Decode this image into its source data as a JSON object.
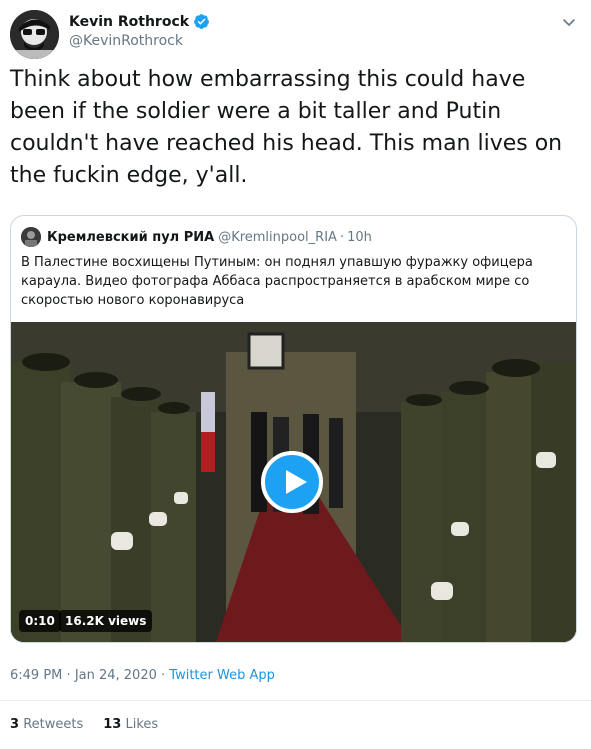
{
  "author": {
    "name": "Kevin Rothrock",
    "handle": "@KevinRothrock",
    "verified_icon": "verified-badge-icon",
    "avatar_icon": "avatar-icon"
  },
  "tweet": {
    "text": "Think about how embarrassing this could have been if the soldier were a bit taller and Putin couldn't have reached his head. This man lives on the fuckin edge, y'all."
  },
  "quoted_tweet": {
    "name": "Кремлевский пул РИА",
    "handle": "@Kremlinpool_RIA",
    "separator": "·",
    "time": "10h",
    "text": "В Палестине восхищены Путиным: он поднял упавшую фуражку офицера караула. Видео фотографа Аббаса распространяется в арабском мире со скоростью нового коронавируса",
    "video": {
      "duration": "0:10",
      "views": "16.2K views",
      "play_icon": "play-icon"
    }
  },
  "meta": {
    "time": "6:49 PM",
    "separator1": "·",
    "date": "Jan 24, 2020",
    "separator2": "·",
    "source": "Twitter Web App"
  },
  "stats": {
    "retweets_count": "3",
    "retweets_label": "Retweets",
    "likes_count": "13",
    "likes_label": "Likes"
  },
  "colors": {
    "accent": "#1da1f2",
    "link": "#1b95e0",
    "secondary_text": "#657786",
    "border": "#ccd6dd"
  }
}
